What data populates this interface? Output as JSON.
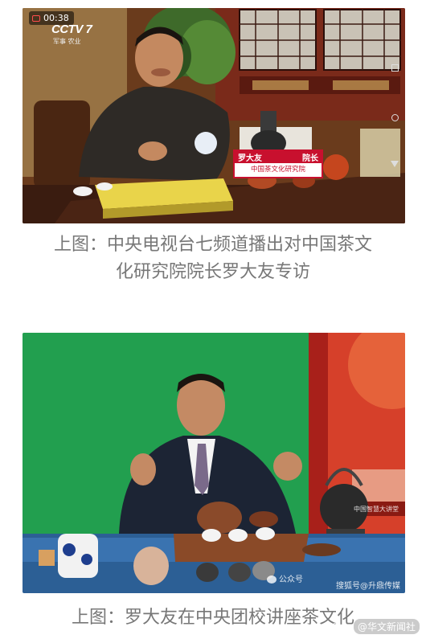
{
  "photo1": {
    "video_time": "00:38",
    "channel_logo": "CCTV 7",
    "channel_sub": "军事 农业",
    "nameplate_name": "罗大友",
    "nameplate_title": "院长",
    "nameplate_org": "中国茶文化研究院",
    "colors": {
      "red": "#c8102e",
      "wall": "#7a2a1a",
      "table": "#e9d44a"
    }
  },
  "caption1": {
    "line1": "上图：中央电视台七频道播出对中国茶文",
    "line2": "化研究院院长罗大友专访"
  },
  "photo2": {
    "watermark_account": "公众号",
    "watermark_brand": "搜狐号@升鼎传媒",
    "sign_text": "中国智慧大讲堂",
    "colors": {
      "green": "#1f9a4a",
      "red": "#d6402a",
      "suit": "#1c2434"
    }
  },
  "caption2": {
    "line1": "上图：罗大友在中央团校讲座茶文化"
  },
  "overlay": {
    "left_text": "公众号",
    "right_text": "@华文新闻社"
  }
}
